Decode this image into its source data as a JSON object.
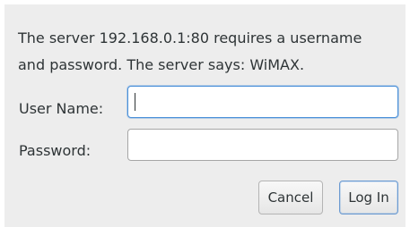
{
  "dialog": {
    "message_line1": "The server 192.168.0.1:80 requires a username",
    "message_line2": "and password. The server says: WiMAX."
  },
  "form": {
    "username_label": "User Name:",
    "username_value": "",
    "password_label": "Password:",
    "password_value": ""
  },
  "buttons": {
    "cancel_label": "Cancel",
    "login_label": "Log In"
  },
  "colors": {
    "dialog_background": "#ededed",
    "text": "#2e3436",
    "focus_accent": "#4a90d9"
  }
}
